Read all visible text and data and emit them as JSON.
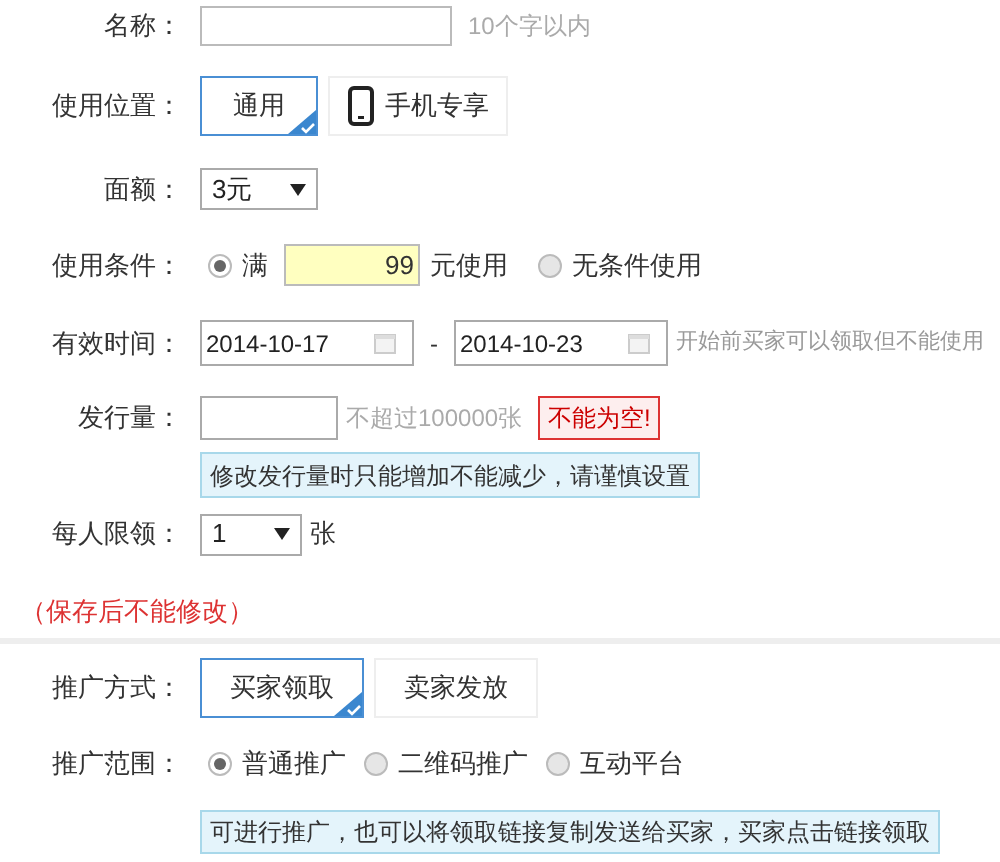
{
  "name": {
    "label": "名称：",
    "hint": "10个字以内"
  },
  "position": {
    "label": "使用位置：",
    "options": [
      {
        "label": "通用",
        "kind": "text",
        "selected": true
      },
      {
        "label": "手机专享",
        "kind": "phone",
        "selected": false
      }
    ]
  },
  "denomination": {
    "label": "面额：",
    "value": "3元"
  },
  "condition": {
    "label": "使用条件：",
    "options": [
      {
        "label": "满",
        "selected": true,
        "amount": "99",
        "suffix": "元使用"
      },
      {
        "label": "无条件使用",
        "selected": false
      }
    ]
  },
  "validity": {
    "label": "有效时间：",
    "start": "2014-10-17",
    "separator": "-",
    "end": "2014-10-23",
    "hint": "开始前买家可以领取但不能使用"
  },
  "quantity": {
    "label": "发行量：",
    "hint": "不超过100000张",
    "error": "不能为空!",
    "notice": "修改发行量时只能增加不能减少，请谨慎设置"
  },
  "limit": {
    "label": "每人限领：",
    "value": "1",
    "unit": "张"
  },
  "warning": "（保存后不能修改）",
  "promo_method": {
    "label": "推广方式：",
    "options": [
      {
        "label": "买家领取",
        "selected": true
      },
      {
        "label": "卖家发放",
        "selected": false
      }
    ]
  },
  "promo_scope": {
    "label": "推广范围：",
    "options": [
      {
        "label": "普通推广",
        "selected": true
      },
      {
        "label": "二维码推广",
        "selected": false
      },
      {
        "label": "互动平台",
        "selected": false
      }
    ],
    "notice": "可进行推广，也可以将领取链接复制发送给买家，买家点击链接领取"
  }
}
